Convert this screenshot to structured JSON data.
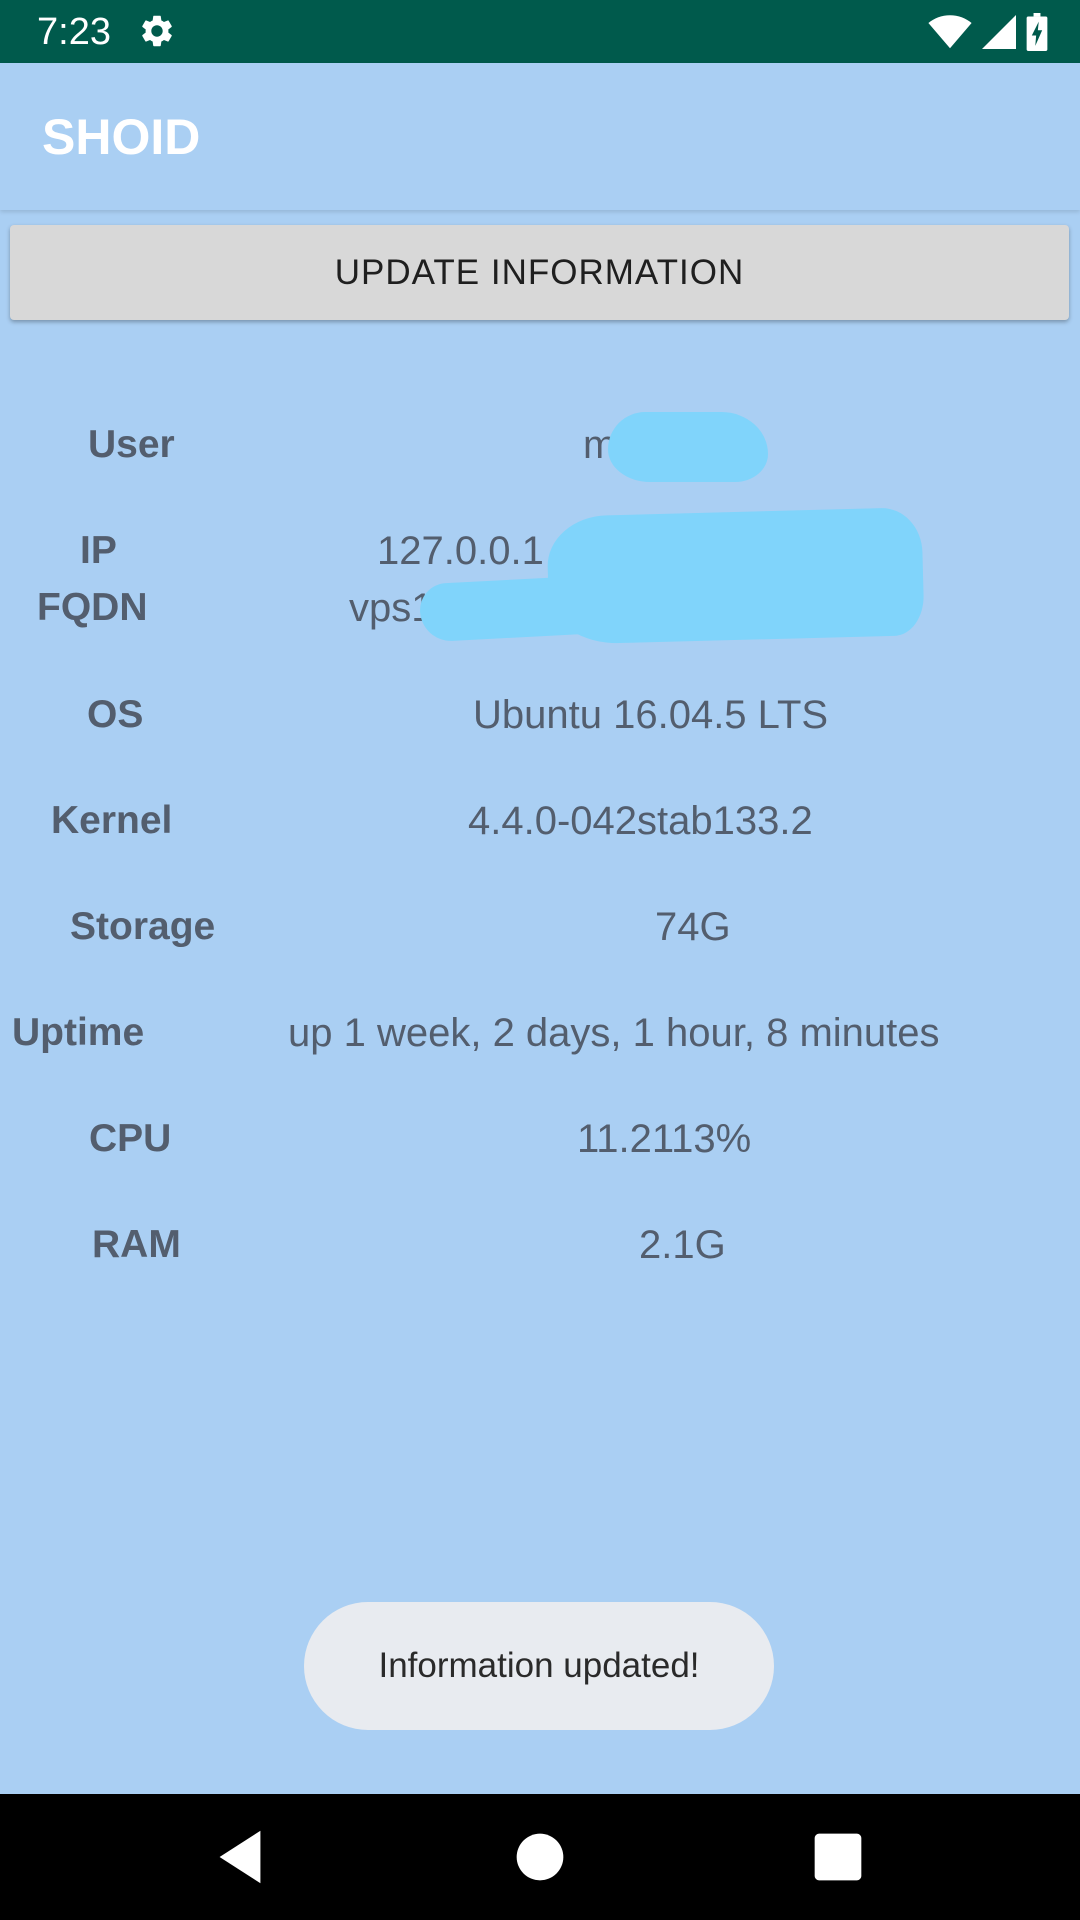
{
  "status_bar": {
    "time": "7:23",
    "icons": [
      "gear-icon",
      "wifi-icon",
      "signal-icon",
      "battery-icon"
    ]
  },
  "app_bar": {
    "title": "SHOID"
  },
  "update_button": {
    "label": "UPDATE INFORMATION"
  },
  "info": {
    "user": {
      "label": "User",
      "value": "m"
    },
    "ip": {
      "label": "IP",
      "value": "127.0.0.1"
    },
    "fqdn": {
      "label": "FQDN",
      "value": "vps1"
    },
    "os": {
      "label": "OS",
      "value": "Ubuntu 16.04.5 LTS"
    },
    "kernel": {
      "label": "Kernel",
      "value": "4.4.0-042stab133.2"
    },
    "storage": {
      "label": "Storage",
      "value": "74G"
    },
    "uptime": {
      "label": "Uptime",
      "value": "up 1 week, 2 days, 1 hour, 8 minutes"
    },
    "cpu": {
      "label": "CPU",
      "value": "11.2113%"
    },
    "ram": {
      "label": "RAM",
      "value": "2.1G"
    }
  },
  "toast": {
    "text": "Information updated!"
  },
  "nav_bar": {
    "icons": [
      "back-icon",
      "home-icon",
      "recents-icon"
    ]
  },
  "colors": {
    "status_bar": "#005a4c",
    "background": "#aacff3",
    "redaction": "#80d4fb",
    "text": "#535e6e"
  }
}
